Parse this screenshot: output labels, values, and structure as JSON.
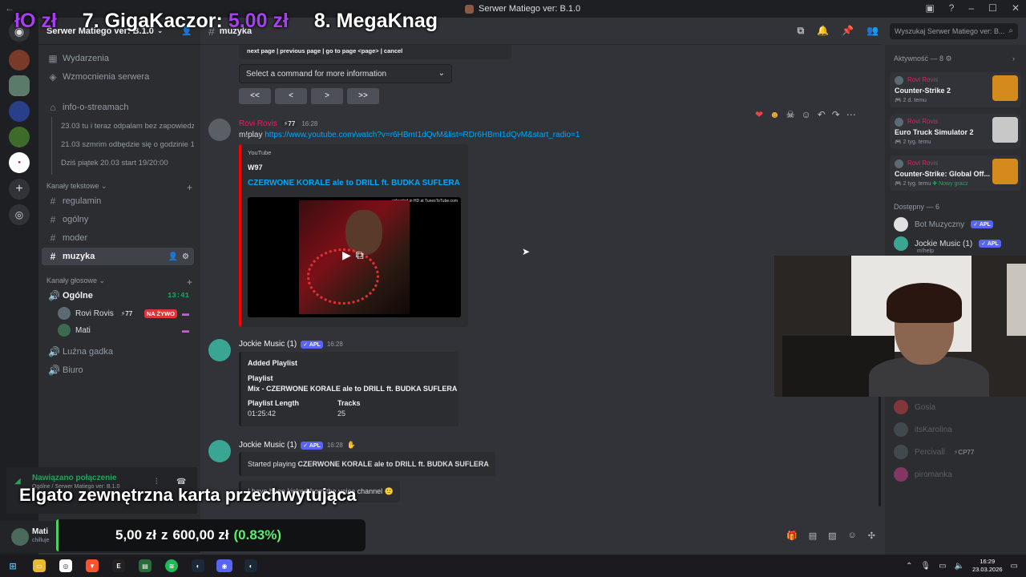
{
  "window": {
    "title": "Serwer Matiego ver: B.1.0"
  },
  "overlay": {
    "ticker": [
      {
        "text": "",
        "amount": "łO zł"
      },
      {
        "text": "7. GigaKaczor:",
        "amount": "5.00 zł"
      },
      {
        "text": "8. MegaKnag",
        "amount": ""
      }
    ],
    "caption": "Elgato zewnętrzna karta przechwytująca",
    "goal": {
      "current": "5,00 zł",
      "sep": "z",
      "target": "600,00 zł",
      "percent": "(0.83%)",
      "fraction": 0.0083
    }
  },
  "server": {
    "name": "Serwer Matiego ver: B.1.0",
    "events_label": "Wydarzenia",
    "boosts_label": "Wzmocnienia serwera",
    "stream_channel": "info-o-streamach",
    "threads": [
      "23.03 tu i teraz odpalam bez zapowiedzi",
      "21.03 szmrim odbędzie się o godzinie 1...",
      "Dziś piątek 20.03 start 19/20:00"
    ],
    "text_category": "Kanały tekstowe",
    "text_channels": [
      "regulamin",
      "ogólny",
      "moder",
      "muzyka"
    ],
    "voice_category": "Kanały głosowe",
    "voice_channels": [
      {
        "name": "Ogólne",
        "time": "13:41"
      },
      {
        "name": "Luźna gadka"
      },
      {
        "name": "Biuro"
      }
    ],
    "voice_users": [
      {
        "name": "Rovi Rovis",
        "boost": "77",
        "live": "NA ŻYWO"
      },
      {
        "name": "Mati"
      }
    ]
  },
  "voice_panel": {
    "status": "Nawiązano połączenie",
    "location": "Ogólne / Serwer Matiego ver: B.1.0"
  },
  "user_panel": {
    "name": "Mati",
    "status": "chilluje"
  },
  "channel": {
    "name": "muzyka",
    "search_placeholder": "Wyszukaj Serwer Matiego ver: B..."
  },
  "chat": {
    "pagination_text": "next page | previous page | go to page <page> | cancel",
    "select_placeholder": "Select a command for more information",
    "pager": [
      "<<",
      "<",
      ">",
      ">>"
    ],
    "messages": [
      {
        "author": "Rovi Rovis",
        "boost": "77",
        "time": "16:28",
        "prefix": "m!play ",
        "link": "https://www.youtube.com/watch?v=r6HBmI1dQvM&list=RDr6HBmI1dQvM&start_radio=1",
        "embed_provider": "YouTube",
        "embed_author": "W97",
        "embed_title": "CZERWONE KORALE ale to DRILL ft. BUDKA SUFLERA",
        "video_caption": "uploaded in HD at TunesToTube.com"
      },
      {
        "author": "Jockie Music (1)",
        "badge": "APL",
        "time": "16:28",
        "embed_heading": "Added Playlist",
        "field_playlist_name": "Playlist",
        "field_playlist_value": "Mix - CZERWONE KORALE ale to DRILL ft. BUDKA SUFLERA",
        "field_length_name": "Playlist Length",
        "field_length_value": "01:25:42",
        "field_tracks_name": "Tracks",
        "field_tracks_value": "25"
      },
      {
        "author": "Jockie Music (1)",
        "badge": "APL",
        "time": "16:28",
        "started_prefix": "Started playing ",
        "started_title": "CZERWONE KORALE ale to DRILL ft. BUDKA SUFLERA",
        "kicked": "I have been kicked from the voice channel 🙁"
      }
    ]
  },
  "members": {
    "activity_header": "Aktywność — 8",
    "activities": [
      {
        "user": "Rovi Rovis",
        "game": "Counter-Strike 2",
        "time": "2 d. temu",
        "extra": "",
        "color": "#d48a1d"
      },
      {
        "user": "Rovi Rovis",
        "game": "Euro Truck Simulator 2",
        "time": "2 tyg. temu",
        "extra": "",
        "color": "#c8c8c8"
      },
      {
        "user": "Rovi Rovis",
        "game": "Counter-Strike: Global Off...",
        "time": "2 tyg. temu",
        "extra": "Nowy gracz",
        "color": "#d48a1d"
      }
    ],
    "available_header": "Dostępny — 6",
    "online": [
      {
        "name": "Bot Muzyczny",
        "badge": "APL"
      },
      {
        "name": "Jockie Music (1)",
        "badge": "APL",
        "sub": "m!help"
      }
    ],
    "offline": [
      {
        "name": "Gosia"
      },
      {
        "name": "itsKarolina"
      },
      {
        "name": "Percivall",
        "boost": "CP77"
      },
      {
        "name": "piromanka"
      }
    ]
  },
  "taskbar": {
    "time": "16:29",
    "date": "23.03.2026"
  }
}
